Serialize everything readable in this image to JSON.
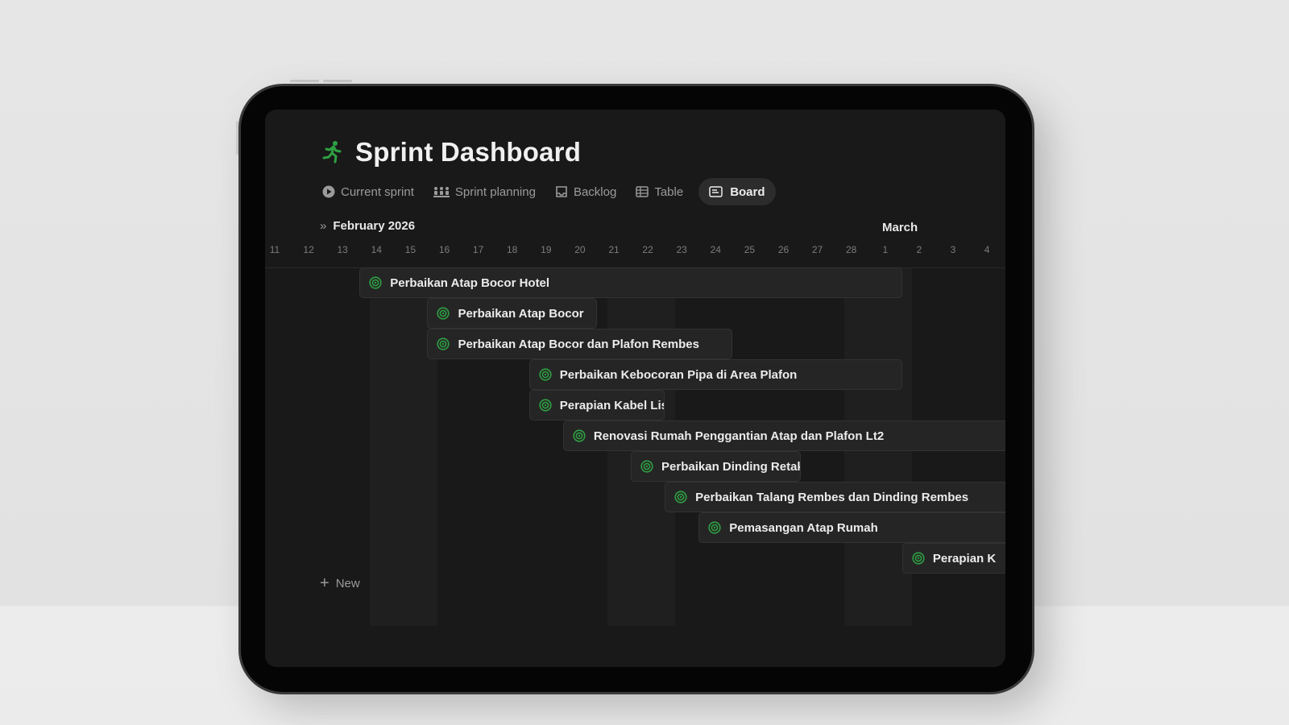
{
  "header": {
    "title": "Sprint Dashboard",
    "icon": "running-person-icon"
  },
  "tabs": [
    {
      "label": "Current sprint",
      "icon": "play-circle-icon",
      "active": false
    },
    {
      "label": "Sprint planning",
      "icon": "team-icon",
      "active": false
    },
    {
      "label": "Backlog",
      "icon": "inbox-icon",
      "active": false
    },
    {
      "label": "Table",
      "icon": "table-icon",
      "active": false
    },
    {
      "label": "Board",
      "icon": "board-icon",
      "active": true
    }
  ],
  "timeline": {
    "month_primary": "February 2026",
    "month_secondary": "March",
    "days": [
      "11",
      "12",
      "13",
      "14",
      "15",
      "16",
      "17",
      "18",
      "19",
      "20",
      "21",
      "22",
      "23",
      "24",
      "25",
      "26",
      "27",
      "28",
      "1",
      "2",
      "3",
      "4"
    ]
  },
  "tasks": [
    {
      "label": "Perbaikan Atap Bocor Hotel"
    },
    {
      "label": "Perbaikan Atap Bocor"
    },
    {
      "label": "Perbaikan Atap Bocor dan Plafon Rembes"
    },
    {
      "label": "Perbaikan Kebocoran Pipa di Area Plafon"
    },
    {
      "label": "Perapian Kabel Listrik"
    },
    {
      "label": "Renovasi Rumah Penggantian Atap dan Plafon Lt2"
    },
    {
      "label": "Perbaikan Dinding Retak dan Pipa Wastafel Bocor"
    },
    {
      "label": "Perbaikan Talang Rembes dan Dinding Rembes"
    },
    {
      "label": "Pemasangan Atap Rumah"
    },
    {
      "label": "Perapian K"
    }
  ],
  "new_label": "New",
  "colors": {
    "accent": "#2ea043",
    "background": "#191919",
    "bar": "#252525"
  }
}
